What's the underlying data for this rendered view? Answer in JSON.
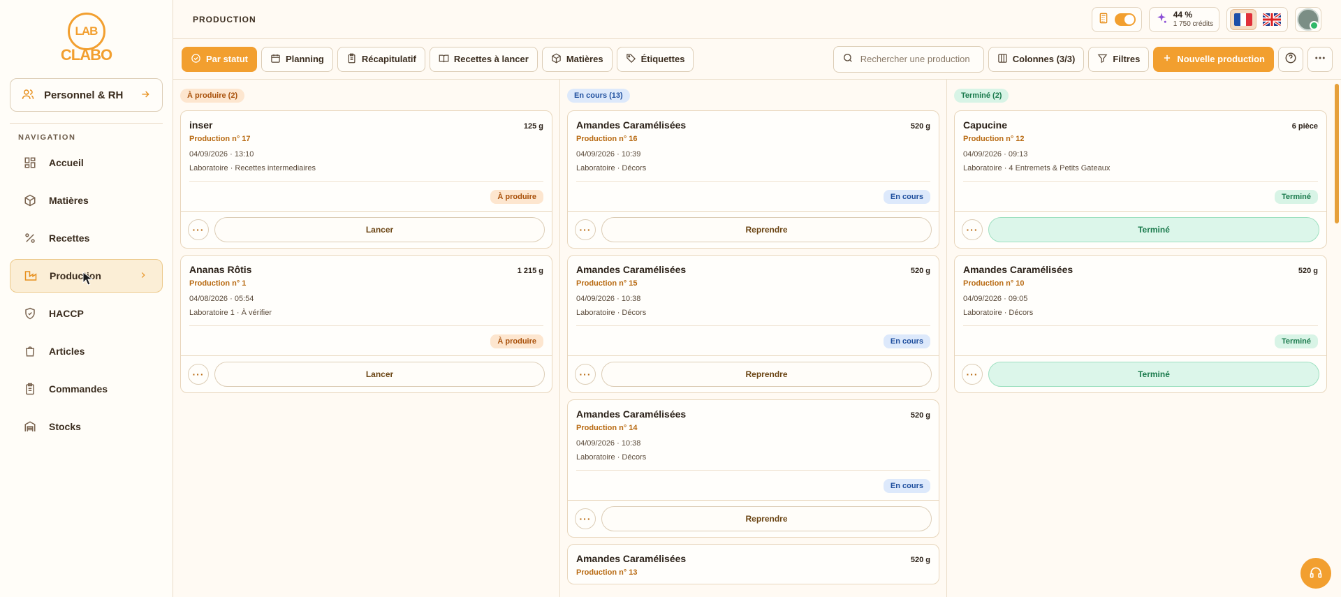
{
  "sidebar": {
    "logo_top": "LAB",
    "logo_bottom": "CLABO",
    "rh_button": "Personnel & RH",
    "nav_title": "NAVIGATION",
    "items": [
      {
        "label": "Accueil"
      },
      {
        "label": "Matières"
      },
      {
        "label": "Recettes"
      },
      {
        "label": "Production"
      },
      {
        "label": "HACCP"
      },
      {
        "label": "Articles"
      },
      {
        "label": "Commandes"
      },
      {
        "label": "Stocks"
      }
    ]
  },
  "header": {
    "title": "PRODUCTION",
    "credits_pct": "44 %",
    "credits_sub": "1 750 crédits"
  },
  "toolbar": {
    "tabs": [
      "Par statut",
      "Planning",
      "Récapitulatif",
      "Recettes à lancer",
      "Matières",
      "Étiquettes"
    ],
    "search_placeholder": "Rechercher une production",
    "columns": "Colonnes (3/3)",
    "filters": "Filtres",
    "new": "Nouvelle production"
  },
  "colors": {
    "accent": "#f29f2f"
  },
  "columns": [
    {
      "title": "À produire (2)",
      "cards": [
        {
          "name": "inser",
          "qty": "125 g",
          "num": "Production n° 17",
          "date": "04/09/2026 · 13:10",
          "loc": "Laboratoire · Recettes intermediaires",
          "status": "À produire",
          "action": "Lancer"
        },
        {
          "name": "Ananas Rôtis",
          "qty": "1 215 g",
          "num": "Production n° 1",
          "date": "04/08/2026 · 05:54",
          "loc": "Laboratoire 1 · À vérifier",
          "status": "À produire",
          "action": "Lancer"
        }
      ]
    },
    {
      "title": "En cours (13)",
      "cards": [
        {
          "name": "Amandes Caramélisées",
          "qty": "520 g",
          "num": "Production n° 16",
          "date": "04/09/2026 · 10:39",
          "loc": "Laboratoire · Décors",
          "status": "En cours",
          "action": "Reprendre"
        },
        {
          "name": "Amandes Caramélisées",
          "qty": "520 g",
          "num": "Production n° 15",
          "date": "04/09/2026 · 10:38",
          "loc": "Laboratoire · Décors",
          "status": "En cours",
          "action": "Reprendre"
        },
        {
          "name": "Amandes Caramélisées",
          "qty": "520 g",
          "num": "Production n° 14",
          "date": "04/09/2026 · 10:38",
          "loc": "Laboratoire · Décors",
          "status": "En cours",
          "action": "Reprendre"
        },
        {
          "name": "Amandes Caramélisées",
          "qty": "520 g",
          "num": "Production n° 13",
          "date": "",
          "loc": "",
          "status": "",
          "action": ""
        }
      ]
    },
    {
      "title": "Terminé (2)",
      "cards": [
        {
          "name": "Capucine",
          "qty": "6 pièce",
          "num": "Production n° 12",
          "date": "04/09/2026 · 09:13",
          "loc": "Laboratoire · 4 Entremets & Petits Gateaux",
          "status": "Terminé",
          "action": "Terminé"
        },
        {
          "name": "Amandes Caramélisées",
          "qty": "520 g",
          "num": "Production n° 10",
          "date": "04/09/2026 · 09:05",
          "loc": "Laboratoire · Décors",
          "status": "Terminé",
          "action": "Terminé"
        }
      ]
    }
  ]
}
